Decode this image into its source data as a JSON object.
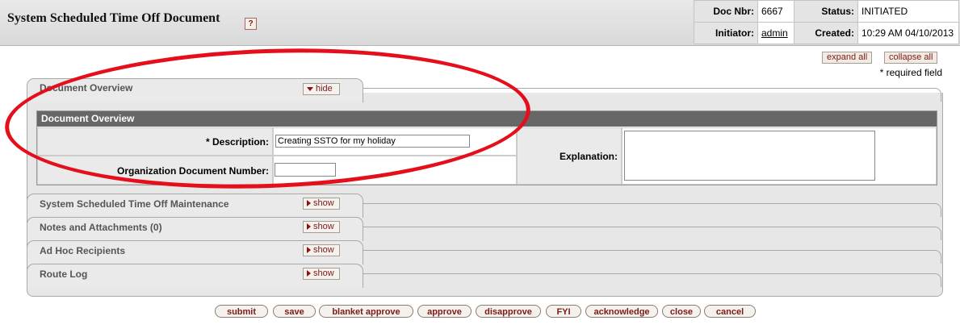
{
  "header": {
    "title": "System Scheduled Time Off Document",
    "help_icon": "?",
    "doc_nbr_label": "Doc Nbr:",
    "doc_nbr": "6667",
    "status_label": "Status:",
    "status": "INITIATED",
    "initiator_label": "Initiator:",
    "initiator": "admin",
    "created_label": "Created:",
    "created": "10:29 AM 04/10/2013"
  },
  "controls": {
    "expand_all": "expand all",
    "collapse_all": "collapse all",
    "required_note": "* required field"
  },
  "tabs": [
    {
      "label": "Document Overview",
      "button": "hide",
      "state": "expanded"
    },
    {
      "label": "System Scheduled Time Off Maintenance",
      "button": "show",
      "state": "collapsed"
    },
    {
      "label": "Notes and Attachments (0)",
      "button": "show",
      "state": "collapsed"
    },
    {
      "label": "Ad Hoc Recipients",
      "button": "show",
      "state": "collapsed"
    },
    {
      "label": "Route Log",
      "button": "show",
      "state": "collapsed"
    }
  ],
  "overview": {
    "section_title": "Document Overview",
    "description_label": "*  Description:",
    "description_value": "Creating SSTO for my holiday",
    "org_doc_number_label": "Organization Document Number:",
    "org_doc_number_value": "",
    "explanation_label": "Explanation:",
    "explanation_value": ""
  },
  "buttons": [
    "submit",
    "save",
    "blanket approve",
    "approve",
    "disapprove",
    "FYI",
    "acknowledge",
    "close",
    "cancel"
  ],
  "colors": {
    "annotation_ellipse": "#e40f1b",
    "section_header": "#676767",
    "button_text": "#7a1a1a"
  }
}
